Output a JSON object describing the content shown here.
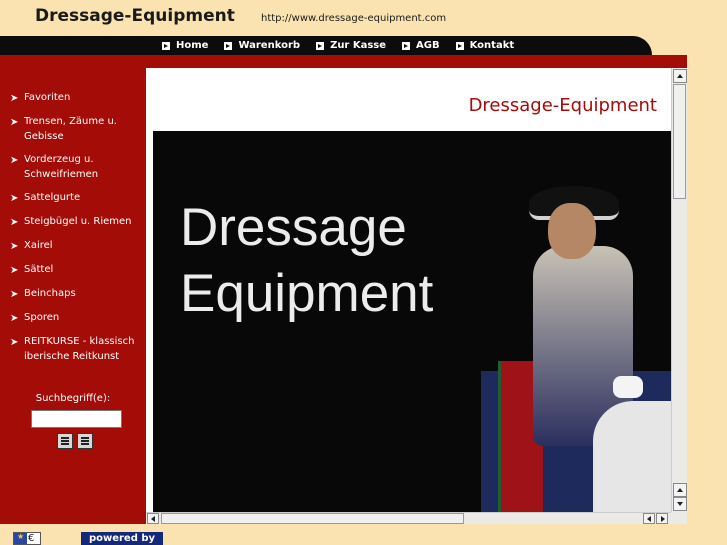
{
  "header": {
    "title": "Dressage-Equipment",
    "url": "http://www.dressage-equipment.com"
  },
  "nav": {
    "items": [
      {
        "label": "Home",
        "icon": "arrow-box-icon"
      },
      {
        "label": "Warenkorb",
        "icon": "arrow-box-icon"
      },
      {
        "label": "Zur Kasse",
        "icon": "arrow-box-icon"
      },
      {
        "label": "AGB",
        "icon": "arrow-box-icon"
      },
      {
        "label": "Kontakt",
        "icon": "arrow-box-icon"
      }
    ]
  },
  "sidebar": {
    "items": [
      {
        "label": "Favoriten"
      },
      {
        "label": "Trensen, Zäume u. Gebisse"
      },
      {
        "label": "Vorderzeug u. Schweifriemen"
      },
      {
        "label": "Sattelgurte"
      },
      {
        "label": "Steigbügel u. Riemen"
      },
      {
        "label": "Xairel"
      },
      {
        "label": "Sättel"
      },
      {
        "label": "Beinchaps"
      },
      {
        "label": "Sporen"
      },
      {
        "label": "REITKURSE - klassisch iberische Reitkunst"
      }
    ],
    "bullet": "➤",
    "search": {
      "label": "Suchbegriff(e):",
      "value": ""
    }
  },
  "content": {
    "title": "Dressage-Equipment",
    "hero_text": [
      "Dressage",
      "Equipment"
    ]
  },
  "footer": {
    "eu_symbol": "€",
    "powered_by": "powered by"
  },
  "colors": {
    "background": "#fbe3b1",
    "sidebar": "#a40c08",
    "navbar": "#0c0c0c",
    "accent_title": "#a40c08",
    "powered_badge": "#16287a"
  }
}
